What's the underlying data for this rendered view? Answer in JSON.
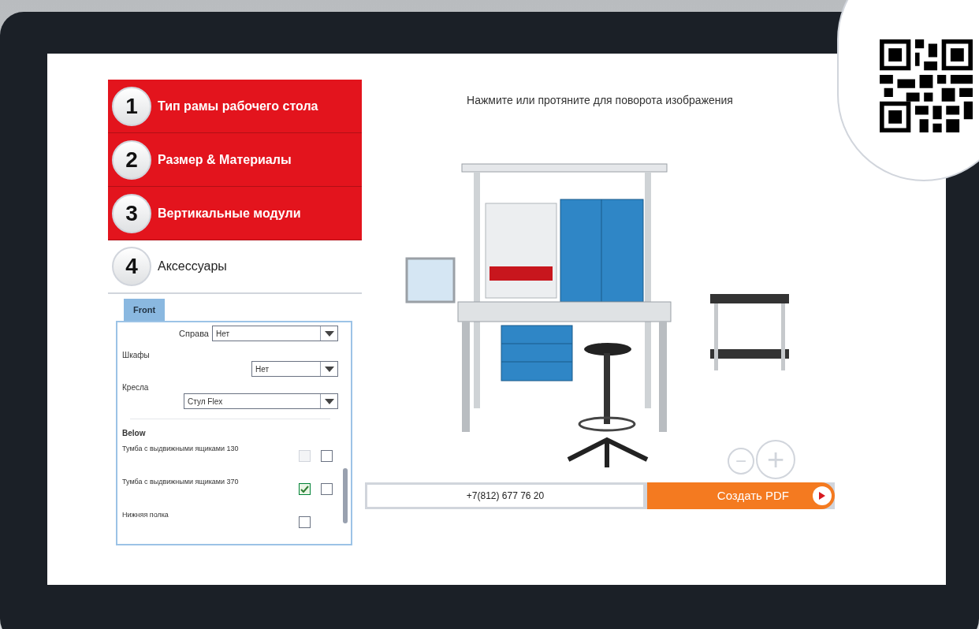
{
  "steps": [
    {
      "number": "1",
      "label": "Тип рамы рабочего стола",
      "completed": true
    },
    {
      "number": "2",
      "label": "Размер & Материалы",
      "completed": true
    },
    {
      "number": "3",
      "label": "Вертикальные модули",
      "completed": true
    },
    {
      "number": "4",
      "label": "Аксессуары",
      "completed": false
    }
  ],
  "tabs": [
    {
      "label": "Front",
      "selected": true
    }
  ],
  "selects": [
    {
      "label": "Справа",
      "value": "Нет",
      "kind": "inline"
    },
    {
      "label": "Шкафы",
      "value": "Нет",
      "kind": "short"
    },
    {
      "label": "Кресла",
      "value": "Стул Flex",
      "kind": "wide"
    }
  ],
  "section_title": "Below",
  "options": [
    {
      "label": "Тумба с выдвижными ящиками 130",
      "checkboxes": [
        {
          "checked": false,
          "disabled": true
        },
        {
          "checked": false,
          "disabled": false
        }
      ]
    },
    {
      "label": "Тумба с выдвижными ящиками 370",
      "checkboxes": [
        {
          "checked": true,
          "disabled": false
        },
        {
          "checked": false,
          "disabled": false
        }
      ]
    },
    {
      "label": "Нижняя полка",
      "checkboxes": [
        {
          "checked": false,
          "disabled": false
        }
      ]
    }
  ],
  "viewer": {
    "hint": "Нажмите или протяните для поворота изображения",
    "zoom_out": "−",
    "zoom_in": "+"
  },
  "footer": {
    "phone": "+7(812) 677 76 20",
    "pdf_button": "Создать PDF"
  }
}
